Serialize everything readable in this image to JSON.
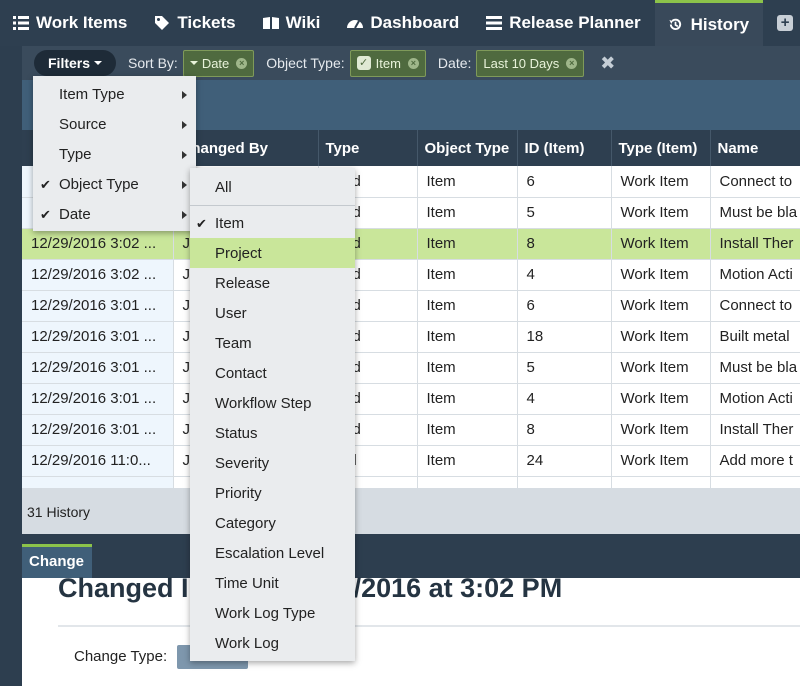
{
  "nav": {
    "tabs": [
      {
        "label": "Work Items",
        "icon": "list-icon"
      },
      {
        "label": "Tickets",
        "icon": "tag-icon"
      },
      {
        "label": "Wiki",
        "icon": "book-icon"
      },
      {
        "label": "Dashboard",
        "icon": "dashboard-icon"
      },
      {
        "label": "Release Planner",
        "icon": "planner-icon"
      },
      {
        "label": "History",
        "icon": "history-icon",
        "active": true
      }
    ],
    "add_icon": "plus-icon"
  },
  "filterbar": {
    "filters_label": "Filters",
    "sort_label": "Sort By:",
    "sort_value": "Date",
    "object_type_label": "Object Type:",
    "object_type_value": "Item",
    "date_label": "Date:",
    "date_value": "Last 10 Days"
  },
  "table": {
    "columns": [
      "",
      "Changed By",
      "Type",
      "Object Type",
      "ID (Item)",
      "Type (Item)",
      "Name"
    ],
    "rows": [
      [
        "",
        "",
        "nged",
        "Item",
        "6",
        "Work Item",
        "Connect to"
      ],
      [
        "",
        "",
        "nged",
        "Item",
        "5",
        "Work Item",
        "Must be bla"
      ],
      [
        "12/29/2016 3:02 ...",
        "J",
        "nged",
        "Item",
        "8",
        "Work Item",
        "Install Ther"
      ],
      [
        "12/29/2016 3:02 ...",
        "J",
        "nged",
        "Item",
        "4",
        "Work Item",
        "Motion Acti"
      ],
      [
        "12/29/2016 3:01 ...",
        "J",
        "nged",
        "Item",
        "6",
        "Work Item",
        "Connect to"
      ],
      [
        "12/29/2016 3:01 ...",
        "J",
        "nged",
        "Item",
        "18",
        "Work Item",
        "Built metal"
      ],
      [
        "12/29/2016 3:01 ...",
        "J",
        "nged",
        "Item",
        "5",
        "Work Item",
        "Must be bla"
      ],
      [
        "12/29/2016 3:01 ...",
        "J",
        "nged",
        "Item",
        "4",
        "Work Item",
        "Motion Acti"
      ],
      [
        "12/29/2016 3:01 ...",
        "J",
        "nged",
        "Item",
        "8",
        "Work Item",
        "Install Ther"
      ],
      [
        "12/29/2016 11:0...",
        "J",
        "ated",
        "Item",
        "24",
        "Work Item",
        "Add more t"
      ],
      [
        "",
        "",
        "",
        "",
        "",
        "",
        ""
      ]
    ],
    "selected_row": 2
  },
  "footer": {
    "count": "31 History"
  },
  "detail": {
    "tab_label": "Change",
    "title": "Changed I                 n S on 12/29/2016 at 3:02 PM",
    "change_type_label": "Change Type:"
  },
  "filter_menu": {
    "items": [
      {
        "label": "Item Type",
        "checked": false
      },
      {
        "label": "Source",
        "checked": false
      },
      {
        "label": "Type",
        "checked": false
      },
      {
        "label": "Object Type",
        "checked": true
      },
      {
        "label": "Date",
        "checked": true
      }
    ]
  },
  "object_type_menu": {
    "all": "All",
    "items": [
      {
        "label": "Item",
        "checked": true
      },
      {
        "label": "Project",
        "highlighted": true
      },
      {
        "label": "Release"
      },
      {
        "label": "User"
      },
      {
        "label": "Team"
      },
      {
        "label": "Contact"
      },
      {
        "label": "Workflow Step"
      },
      {
        "label": "Status"
      },
      {
        "label": "Severity"
      },
      {
        "label": "Priority"
      },
      {
        "label": "Category"
      },
      {
        "label": "Escalation Level"
      },
      {
        "label": "Time Unit"
      },
      {
        "label": "Work Log Type"
      },
      {
        "label": "Work Log"
      }
    ]
  },
  "colors": {
    "accent": "#8cc34a",
    "nav_bg": "#2e3f50",
    "highlight": "#c9e69a"
  }
}
